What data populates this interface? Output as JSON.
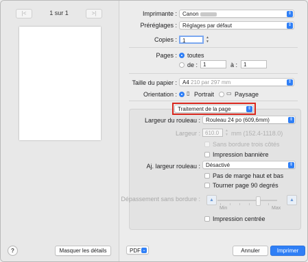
{
  "preview": {
    "page_label": "1 sur 1",
    "first_btn": "|<",
    "prev_btn": "<",
    "next_btn": ">",
    "last_btn": ">|",
    "hide_details": "Masquer les détails",
    "help": "?"
  },
  "printer": {
    "label": "Imprimante :",
    "value": "Canon"
  },
  "presets": {
    "label": "Préréglages :",
    "value": "Réglages par défaut"
  },
  "copies": {
    "label": "Copies :",
    "value": "1"
  },
  "pages": {
    "label": "Pages :",
    "all": "toutes",
    "from_label": "de :",
    "from_value": "1",
    "to_label": "à :",
    "to_value": "1",
    "selected": "all"
  },
  "paper_size": {
    "label": "Taille du papier :",
    "value": "A4",
    "dims": "210 par 297 mm"
  },
  "orientation": {
    "label": "Orientation :",
    "portrait": "Portrait",
    "landscape": "Paysage",
    "selected": "portrait"
  },
  "section_menu": {
    "value": "Traitement de la page"
  },
  "page_processing": {
    "roll_width_label": "Largeur du rouleau :",
    "roll_width_value": "Rouleau 24 po (609,6mm)",
    "width_label": "Largeur :",
    "width_value": "610.0",
    "width_range": "mm (152.4-1118.0)",
    "borderless_three": "Sans bordure trois côtés",
    "banner_print": "Impression bannière",
    "fit_roll_label": "Aj. largeur rouleau :",
    "fit_roll_value": "Désactivé",
    "no_margin": "Pas de marge haut et bas",
    "rotate_90": "Tourner page 90 degrés",
    "overflow_label": "Dépassement sans bordure :",
    "min_label": "Min",
    "max_label": "Max",
    "centered": "Impression centrée"
  },
  "footer": {
    "pdf": "PDF",
    "cancel": "Annuler",
    "print": "Imprimer"
  },
  "colors": {
    "accent": "#2f7ff6",
    "highlight": "#d9261c"
  }
}
